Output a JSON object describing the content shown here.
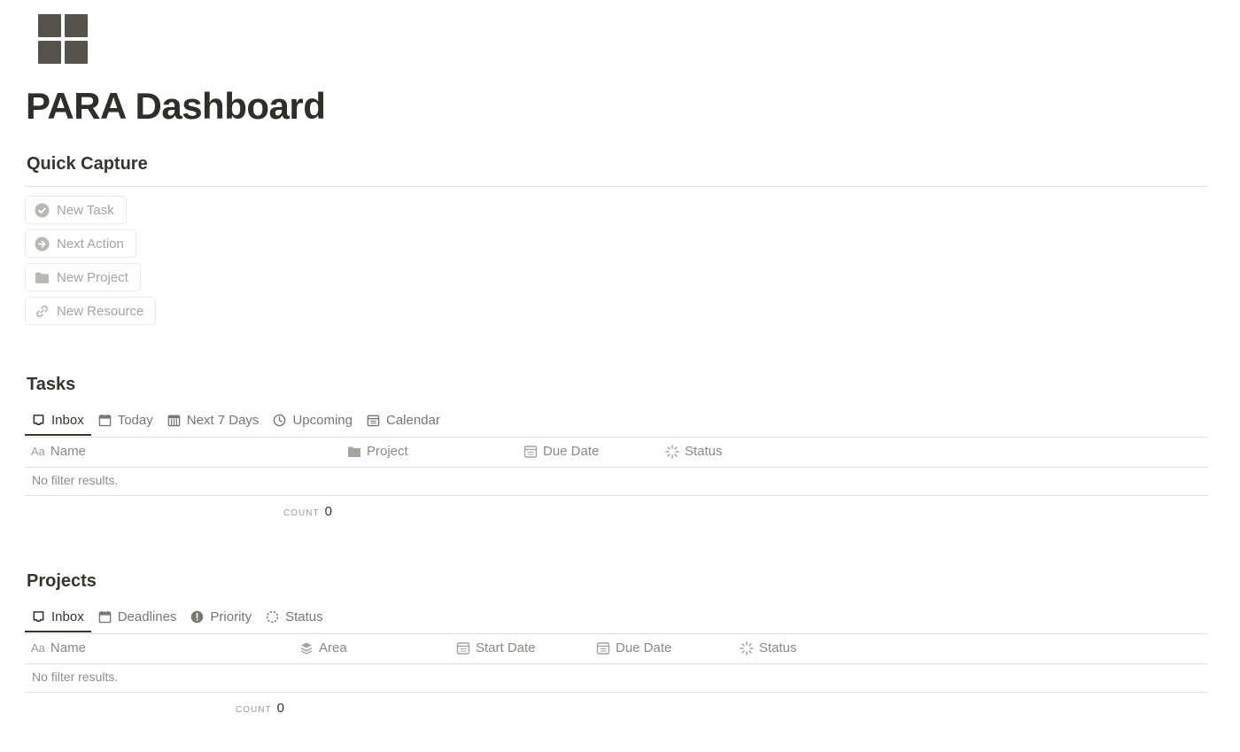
{
  "page": {
    "title": "PARA Dashboard",
    "icon": "grid-icon"
  },
  "quick_capture": {
    "heading": "Quick Capture",
    "buttons": [
      {
        "label": "New Task",
        "icon": "check-circle-icon"
      },
      {
        "label": "Next Action",
        "icon": "arrow-right-circle-icon"
      },
      {
        "label": "New Project",
        "icon": "folder-icon"
      },
      {
        "label": "New Resource",
        "icon": "link-icon"
      }
    ]
  },
  "tasks": {
    "heading": "Tasks",
    "tabs": [
      {
        "label": "Inbox",
        "icon": "inbox-icon",
        "active": true
      },
      {
        "label": "Today",
        "icon": "calendar-icon"
      },
      {
        "label": "Next 7 Days",
        "icon": "calendar-week-icon"
      },
      {
        "label": "Upcoming",
        "icon": "clock-icon"
      },
      {
        "label": "Calendar",
        "icon": "calendar-icon"
      }
    ],
    "columns": [
      {
        "label": "Name",
        "icon": "text-property-icon",
        "prefix": "Aa"
      },
      {
        "label": "Project",
        "icon": "folder-icon"
      },
      {
        "label": "Due Date",
        "icon": "date-property-icon"
      },
      {
        "label": "Status",
        "icon": "status-spinner-icon"
      }
    ],
    "empty_text": "No filter results.",
    "count_label": "COUNT",
    "count_value": "0"
  },
  "projects": {
    "heading": "Projects",
    "tabs": [
      {
        "label": "Inbox",
        "icon": "inbox-icon",
        "active": true
      },
      {
        "label": "Deadlines",
        "icon": "calendar-icon"
      },
      {
        "label": "Priority",
        "icon": "exclamation-circle-icon"
      },
      {
        "label": "Status",
        "icon": "dashed-circle-icon"
      }
    ],
    "columns": [
      {
        "label": "Name",
        "icon": "text-property-icon",
        "prefix": "Aa"
      },
      {
        "label": "Area",
        "icon": "layers-icon"
      },
      {
        "label": "Start Date",
        "icon": "date-property-icon"
      },
      {
        "label": "Due Date",
        "icon": "date-property-icon"
      },
      {
        "label": "Status",
        "icon": "status-spinner-icon"
      }
    ],
    "empty_text": "No filter results.",
    "count_label": "COUNT",
    "count_value": "0"
  },
  "colors": {
    "text": "#37352f",
    "muted": "#a5a4a0",
    "divider": "#e3e2df",
    "icon": "#55534e"
  }
}
